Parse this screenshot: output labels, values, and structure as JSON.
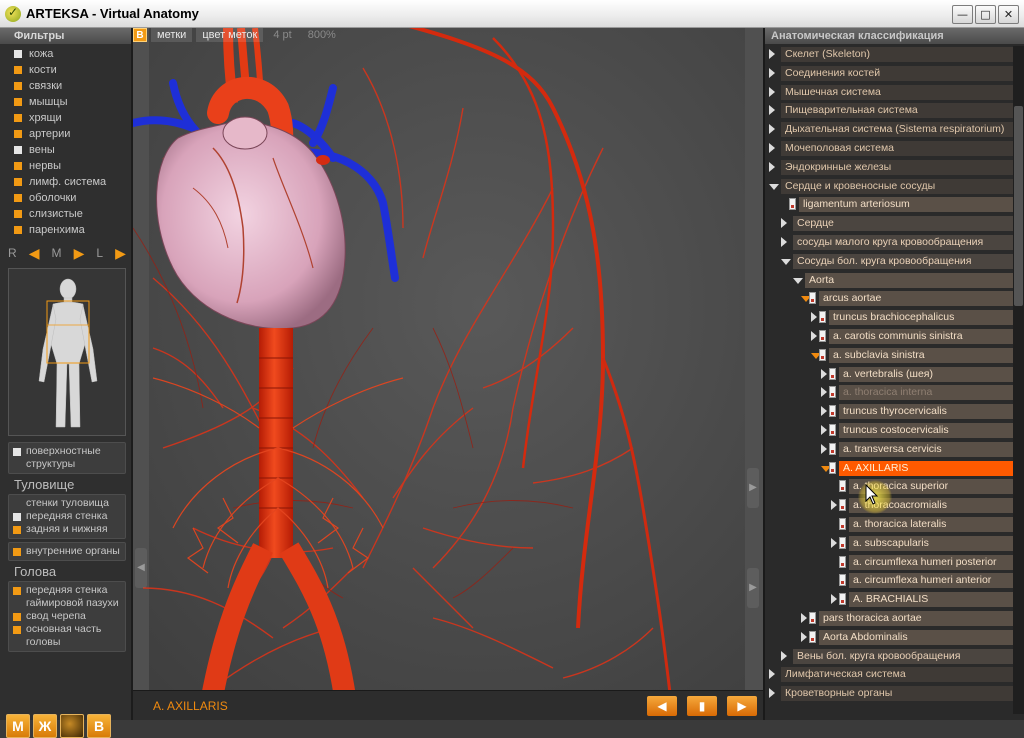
{
  "window": {
    "title": "ARTEKSA - Virtual Anatomy",
    "logo_glyph": "✓"
  },
  "filters": {
    "header": "Фильтры",
    "items": [
      {
        "label": "кожа",
        "on": false
      },
      {
        "label": "кости",
        "on": true
      },
      {
        "label": "связки",
        "on": true
      },
      {
        "label": "мышцы",
        "on": true
      },
      {
        "label": "хрящи",
        "on": true
      },
      {
        "label": "артерии",
        "on": true
      },
      {
        "label": "вены",
        "on": false
      },
      {
        "label": "нервы",
        "on": true
      },
      {
        "label": "лимф. система",
        "on": true
      },
      {
        "label": "оболочки",
        "on": true
      },
      {
        "label": "слизистые",
        "on": true
      },
      {
        "label": "паренхима",
        "on": true
      }
    ]
  },
  "view_switch": {
    "r": "R",
    "m": "M",
    "l": "L"
  },
  "sections": {
    "surface": {
      "label": "поверхностные структуры",
      "on": false
    },
    "torso": {
      "title": "Туловище",
      "items": [
        {
          "label": "стенки туловища",
          "on": null
        },
        {
          "label": "передняя стенка",
          "on": false
        },
        {
          "label": "задняя и нижняя",
          "on": true
        }
      ]
    },
    "internal": {
      "label": "внутренние органы",
      "on": true
    },
    "head": {
      "title": "Голова",
      "items": [
        {
          "label": "передняя стенка гаймировой пазухи",
          "on": true
        },
        {
          "label": "свод черепа",
          "on": true
        },
        {
          "label": "основная часть головы",
          "on": true
        }
      ]
    }
  },
  "mode_buttons": [
    "М",
    "Ж",
    "",
    "В"
  ],
  "viewport": {
    "tab_b": "B",
    "tabs": [
      "метки",
      "цвет меток",
      "4 pt",
      "800%"
    ],
    "selected": "A. AXILLARIS"
  },
  "classification": {
    "header": "Анатомическая классификация",
    "rows": [
      {
        "label": "Скелет (Skeleton)",
        "level": 0,
        "style": "sys",
        "tri": "right"
      },
      {
        "label": "Соединения костей",
        "level": 0,
        "style": "sys",
        "tri": "right"
      },
      {
        "label": "Мышечная система",
        "level": 0,
        "style": "sys",
        "tri": "right"
      },
      {
        "label": "Пищеварительная система",
        "level": 0,
        "style": "sys",
        "tri": "right"
      },
      {
        "label": "Дыхательная система (Sistema respiratorium)",
        "level": 0,
        "style": "sys",
        "tri": "right"
      },
      {
        "label": "Мочеполовая система",
        "level": 0,
        "style": "sys",
        "tri": "right"
      },
      {
        "label": "Эндокринные железы",
        "level": 0,
        "style": "sys",
        "tri": "right"
      },
      {
        "label": "Сердце и кровеносные сосуды",
        "level": 0,
        "style": "sys",
        "tri": "down"
      },
      {
        "label": "ligamentum arteriosum",
        "level": 1,
        "style": "lev3",
        "tri": "none",
        "pin": true
      },
      {
        "label": "Сердце",
        "level": 1,
        "style": "lev2",
        "tri": "right"
      },
      {
        "label": "сосуды малого круга кровообращения",
        "level": 1,
        "style": "lev2",
        "tri": "right"
      },
      {
        "label": "Сосуды бол. круга кровообращения",
        "level": 1,
        "style": "lev2",
        "tri": "down"
      },
      {
        "label": "Aorta",
        "level": 2,
        "style": "lev3",
        "tri": "down"
      },
      {
        "label": "arcus aortae",
        "level": 3,
        "style": "lev3",
        "tri": "downo",
        "pin": true
      },
      {
        "label": "truncus brachiocephalicus",
        "level": 4,
        "style": "lev3",
        "tri": "right",
        "pin": true
      },
      {
        "label": "a. carotis communis sinistra",
        "level": 4,
        "style": "lev3",
        "tri": "right",
        "pin": true
      },
      {
        "label": "a. subclavia sinistra",
        "level": 4,
        "style": "lev3",
        "tri": "downo",
        "pin": true
      },
      {
        "label": "a. vertebralis (шея)",
        "level": 5,
        "style": "lev3",
        "tri": "right",
        "pin": true
      },
      {
        "label": "a. thoracica interna",
        "level": 5,
        "style": "lev3 faded",
        "tri": "right",
        "pin": true
      },
      {
        "label": "truncus thyrocervicalis",
        "level": 5,
        "style": "lev3",
        "tri": "right",
        "pin": true
      },
      {
        "label": "truncus costocervicalis",
        "level": 5,
        "style": "lev3",
        "tri": "right",
        "pin": true
      },
      {
        "label": "a. transversa cervicis",
        "level": 5,
        "style": "lev3",
        "tri": "right",
        "pin": true
      },
      {
        "label": "A. AXILLARIS",
        "level": 5,
        "style": "sel",
        "tri": "downo",
        "pin": true
      },
      {
        "label": "a. thoracica superior",
        "level": 6,
        "style": "lev3",
        "tri": "none",
        "pin": true
      },
      {
        "label": "a. thoracoacromialis",
        "level": 6,
        "style": "lev3",
        "tri": "right",
        "pin": true
      },
      {
        "label": "a. thoracica lateralis",
        "level": 6,
        "style": "lev3",
        "tri": "none",
        "pin": true
      },
      {
        "label": "a. subscapularis",
        "level": 6,
        "style": "lev3",
        "tri": "right",
        "pin": true
      },
      {
        "label": "a. circumflexa humeri posterior",
        "level": 6,
        "style": "lev3",
        "tri": "none",
        "pin": true
      },
      {
        "label": "a. circumflexa humeri anterior",
        "level": 6,
        "style": "lev3",
        "tri": "none",
        "pin": true
      },
      {
        "label": "A. BRACHIALIS",
        "level": 6,
        "style": "lev3",
        "tri": "right",
        "pin": true
      },
      {
        "label": "pars thoracica aortae",
        "level": 3,
        "style": "lev3",
        "tri": "right",
        "pin": true
      },
      {
        "label": "Aorta Abdominalis",
        "level": 3,
        "style": "lev3",
        "tri": "right",
        "pin": true
      },
      {
        "label": "Вены бол. круга кровообращения",
        "level": 1,
        "style": "lev2",
        "tri": "right"
      },
      {
        "label": "Лимфатическая система",
        "level": 0,
        "style": "sys",
        "tri": "right"
      },
      {
        "label": "Кроветворные органы",
        "level": 0,
        "style": "sys",
        "tri": "right"
      }
    ]
  },
  "colors": {
    "accent": "#f29a14",
    "selected": "#ff5a00",
    "artery": "#e5340f",
    "vein": "#1c2fd6",
    "heart": "#dba2b8"
  }
}
